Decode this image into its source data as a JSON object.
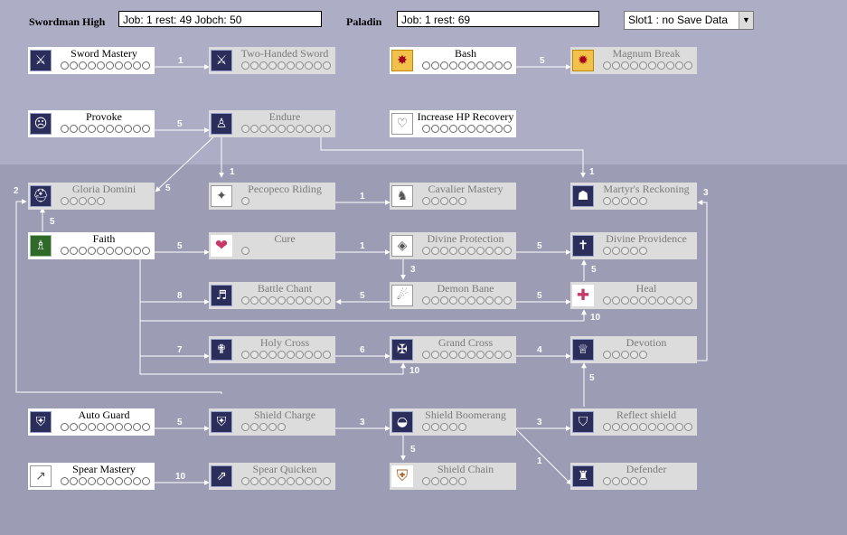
{
  "header": {
    "class1": "Swordman High",
    "class1_status": "Job: 1 rest: 49 Jobch: 50",
    "class2": "Paladin",
    "class2_status": "Job: 1 rest: 69",
    "save_slot": "Slot1 : no Save Data"
  },
  "icons": {
    "sword_mastery": "sword-icon",
    "two_handed_sword": "two-handed-sword-icon",
    "bash": "bash-burst-icon",
    "magnum_break": "magnum-break-icon",
    "provoke": "provoke-face-icon",
    "endure": "endure-figure-icon",
    "increase_hp_recovery": "heart-outline-icon",
    "gloria_domini": "helmet-icon",
    "pecopeco_riding": "pecopeco-bird-icon",
    "cavalier_mastery": "cavalier-icon",
    "martyrs_reckoning": "martyr-icon",
    "faith": "faith-figure-icon",
    "cure": "heart-star-icon",
    "divine_protection": "divine-protection-icon",
    "divine_providence": "cross-icon",
    "battle_chant": "battle-chant-icon",
    "demon_bane": "demon-bane-icon",
    "heal": "heal-heart-icon",
    "holy_cross": "holy-cross-icon",
    "grand_cross": "grand-cross-icon",
    "devotion": "devotion-icon",
    "auto_guard": "auto-guard-icon",
    "shield_charge": "shield-charge-icon",
    "shield_boomerang": "shield-boomerang-icon",
    "reflect_shield": "reflect-shield-icon",
    "shield_chain": "shield-chain-icon",
    "defender": "defender-icon",
    "spear_mastery": "spear-icon",
    "spear_quicken": "spear-quicken-icon"
  },
  "skills": {
    "sword_mastery": {
      "name": "Sword Mastery",
      "max_level": 10,
      "learned": true
    },
    "two_handed_sword": {
      "name": "Two-Handed Sword",
      "max_level": 10,
      "learned": false
    },
    "bash": {
      "name": "Bash",
      "max_level": 10,
      "learned": true
    },
    "magnum_break": {
      "name": "Magnum Break",
      "max_level": 10,
      "learned": false
    },
    "provoke": {
      "name": "Provoke",
      "max_level": 10,
      "learned": true
    },
    "endure": {
      "name": "Endure",
      "max_level": 10,
      "learned": false
    },
    "increase_hp_recovery": {
      "name": "Increase HP Recovery",
      "max_level": 10,
      "learned": true
    },
    "gloria_domini": {
      "name": "Gloria Domini",
      "max_level": 5,
      "learned": false
    },
    "pecopeco_riding": {
      "name": "Pecopeco Riding",
      "max_level": 1,
      "learned": false
    },
    "cavalier_mastery": {
      "name": "Cavalier Mastery",
      "max_level": 5,
      "learned": false
    },
    "martyrs_reckoning": {
      "name": "Martyr's Reckoning",
      "max_level": 5,
      "learned": false
    },
    "faith": {
      "name": "Faith",
      "max_level": 10,
      "learned": true
    },
    "cure": {
      "name": "Cure",
      "max_level": 1,
      "learned": false
    },
    "divine_protection": {
      "name": "Divine Protection",
      "max_level": 10,
      "learned": false
    },
    "divine_providence": {
      "name": "Divine Providence",
      "max_level": 5,
      "learned": false
    },
    "battle_chant": {
      "name": "Battle Chant",
      "max_level": 10,
      "learned": false
    },
    "demon_bane": {
      "name": "Demon Bane",
      "max_level": 10,
      "learned": false
    },
    "heal": {
      "name": "Heal",
      "max_level": 10,
      "learned": false
    },
    "holy_cross": {
      "name": "Holy Cross",
      "max_level": 10,
      "learned": false
    },
    "grand_cross": {
      "name": "Grand Cross",
      "max_level": 10,
      "learned": false
    },
    "devotion": {
      "name": "Devotion",
      "max_level": 5,
      "learned": false
    },
    "auto_guard": {
      "name": "Auto Guard",
      "max_level": 10,
      "learned": true
    },
    "shield_charge": {
      "name": "Shield Charge",
      "max_level": 5,
      "learned": false
    },
    "shield_boomerang": {
      "name": "Shield Boomerang",
      "max_level": 5,
      "learned": false
    },
    "reflect_shield": {
      "name": "Reflect shield",
      "max_level": 10,
      "learned": false
    },
    "shield_chain": {
      "name": "Shield Chain",
      "max_level": 5,
      "learned": false
    },
    "defender": {
      "name": "Defender",
      "max_level": 5,
      "learned": false
    },
    "spear_mastery": {
      "name": "Spear Mastery",
      "max_level": 10,
      "learned": true
    },
    "spear_quicken": {
      "name": "Spear Quicken",
      "max_level": 10,
      "learned": false
    }
  },
  "prerequisites": [
    {
      "from": "sword_mastery",
      "to": "two_handed_sword",
      "level": "1"
    },
    {
      "from": "bash",
      "to": "magnum_break",
      "level": "5"
    },
    {
      "from": "provoke",
      "to": "endure",
      "level": "5"
    },
    {
      "from": "endure",
      "to": "pecopeco_riding",
      "level": "1"
    },
    {
      "from": "endure",
      "to": "gloria_domini",
      "level": "5"
    },
    {
      "from": "endure",
      "to": "martyrs_reckoning",
      "level": "1"
    },
    {
      "from": "faith",
      "to": "gloria_domini",
      "level": "5"
    },
    {
      "from": "shield_charge",
      "to": "gloria_domini",
      "level": "2"
    },
    {
      "from": "pecopeco_riding",
      "to": "cavalier_mastery",
      "level": "1"
    },
    {
      "from": "devotion",
      "to": "martyrs_reckoning",
      "level": "3"
    },
    {
      "from": "faith",
      "to": "cure",
      "level": "5"
    },
    {
      "from": "cure",
      "to": "divine_protection",
      "level": "1"
    },
    {
      "from": "divine_protection",
      "to": "divine_providence",
      "level": "5"
    },
    {
      "from": "divine_protection",
      "to": "demon_bane",
      "level": "3"
    },
    {
      "from": "faith",
      "to": "battle_chant",
      "level": "8"
    },
    {
      "from": "demon_bane",
      "to": "battle_chant",
      "level": "5"
    },
    {
      "from": "demon_bane",
      "to": "heal",
      "level": "5"
    },
    {
      "from": "heal",
      "to": "divine_providence",
      "level": "5"
    },
    {
      "from": "faith",
      "to": "heal",
      "level": "10"
    },
    {
      "from": "faith",
      "to": "holy_cross",
      "level": "7"
    },
    {
      "from": "holy_cross",
      "to": "grand_cross",
      "level": "6"
    },
    {
      "from": "faith",
      "to": "grand_cross",
      "level": "10"
    },
    {
      "from": "grand_cross",
      "to": "devotion",
      "level": "4"
    },
    {
      "from": "reflect_shield",
      "to": "devotion",
      "level": "5"
    },
    {
      "from": "auto_guard",
      "to": "shield_charge",
      "level": "5"
    },
    {
      "from": "shield_charge",
      "to": "shield_boomerang",
      "level": "3"
    },
    {
      "from": "shield_boomerang",
      "to": "reflect_shield",
      "level": "3"
    },
    {
      "from": "shield_boomerang",
      "to": "shield_chain",
      "level": "5"
    },
    {
      "from": "shield_boomerang",
      "to": "defender",
      "level": "1"
    },
    {
      "from": "spear_mastery",
      "to": "spear_quicken",
      "level": "10"
    }
  ]
}
